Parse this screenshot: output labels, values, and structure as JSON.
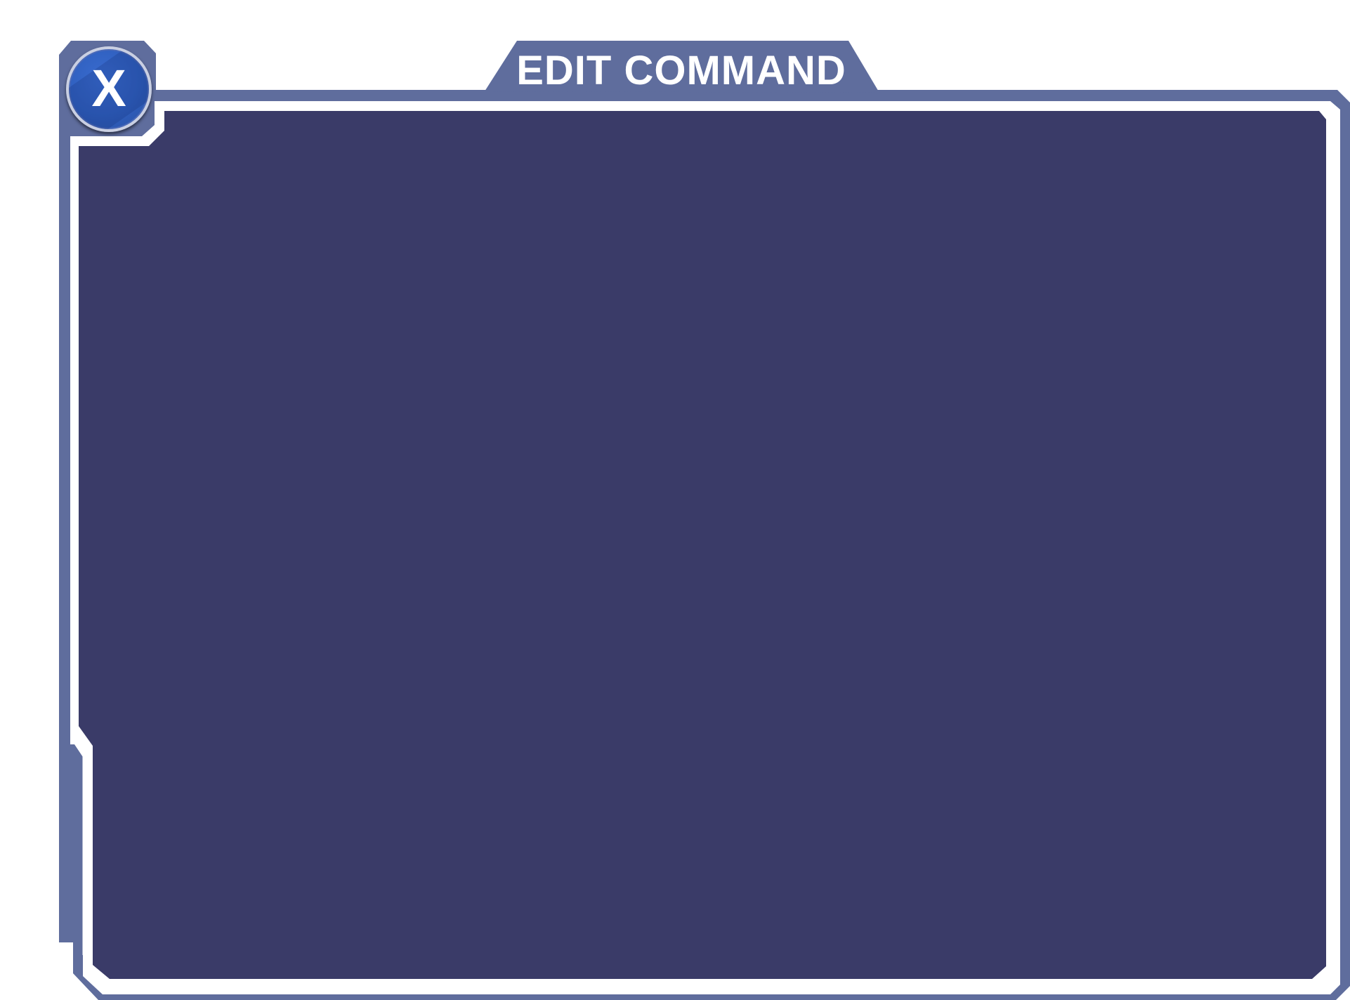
{
  "dialog": {
    "title": "EDIT COMMAND",
    "close_label": "X"
  },
  "colors": {
    "frame": "#5f6d9d",
    "panel": "#3a3b68",
    "border": "#ffffff",
    "close_button": "#2f5fbe"
  }
}
